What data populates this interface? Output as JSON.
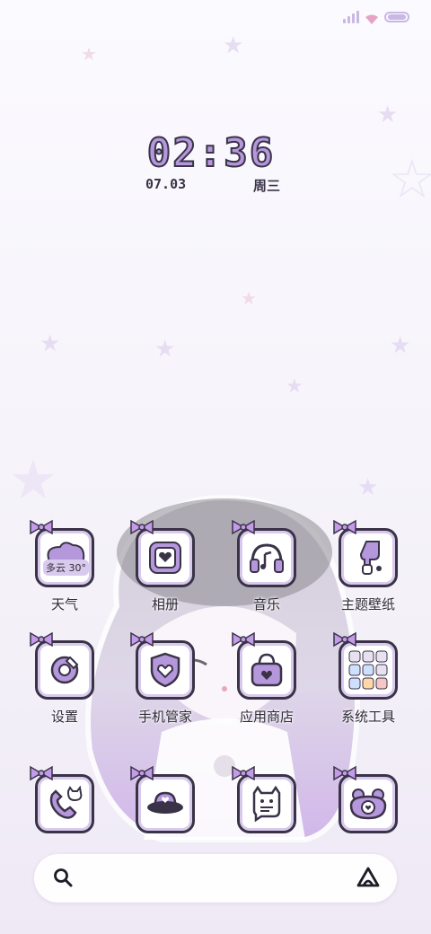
{
  "status_bar": {
    "icons": [
      "signal-icon",
      "wifi-icon",
      "battery-icon"
    ]
  },
  "clock": {
    "time": "02:36",
    "date": "07.03",
    "weekday": "周三"
  },
  "apps": [
    {
      "label": "天气",
      "icon": "weather-icon",
      "detail": "多云 30°"
    },
    {
      "label": "相册",
      "icon": "gallery-icon"
    },
    {
      "label": "音乐",
      "icon": "music-icon"
    },
    {
      "label": "主题壁纸",
      "icon": "theme-brush-icon"
    },
    {
      "label": "设置",
      "icon": "settings-gear-icon"
    },
    {
      "label": "手机管家",
      "icon": "phone-manager-shield-icon"
    },
    {
      "label": "应用商店",
      "icon": "app-store-bag-icon"
    },
    {
      "label": "系统工具",
      "icon": "system-tools-folder-icon"
    },
    {
      "label": "",
      "icon": "phone-cat-icon"
    },
    {
      "label": "",
      "icon": "ufo-icon"
    },
    {
      "label": "",
      "icon": "cat-message-icon"
    },
    {
      "label": "",
      "icon": "frog-heart-icon"
    }
  ],
  "search_bar": {
    "icons": [
      "search-icon",
      "assistant-logo-icon"
    ]
  },
  "colors": {
    "accent": "#b597dc",
    "outline": "#3a3348",
    "tile_inner": "#d8caec"
  }
}
